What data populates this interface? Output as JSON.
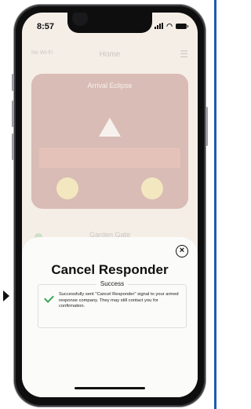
{
  "status_bar": {
    "time": "8:57"
  },
  "background_app": {
    "header_left": "No Wi-Fi",
    "header_title": "Home",
    "card_title": "Arrival Eclipse",
    "row_label": "Garden Gate"
  },
  "modal": {
    "title": "Cancel Responder",
    "result_label": "Success",
    "result_message": "Successfully sent \"Cancel Responder\" signal to your armed response company. They may still contact you for confirmation."
  },
  "colors": {
    "success": "#37a85a",
    "alarm_card": "#7a0e08"
  }
}
